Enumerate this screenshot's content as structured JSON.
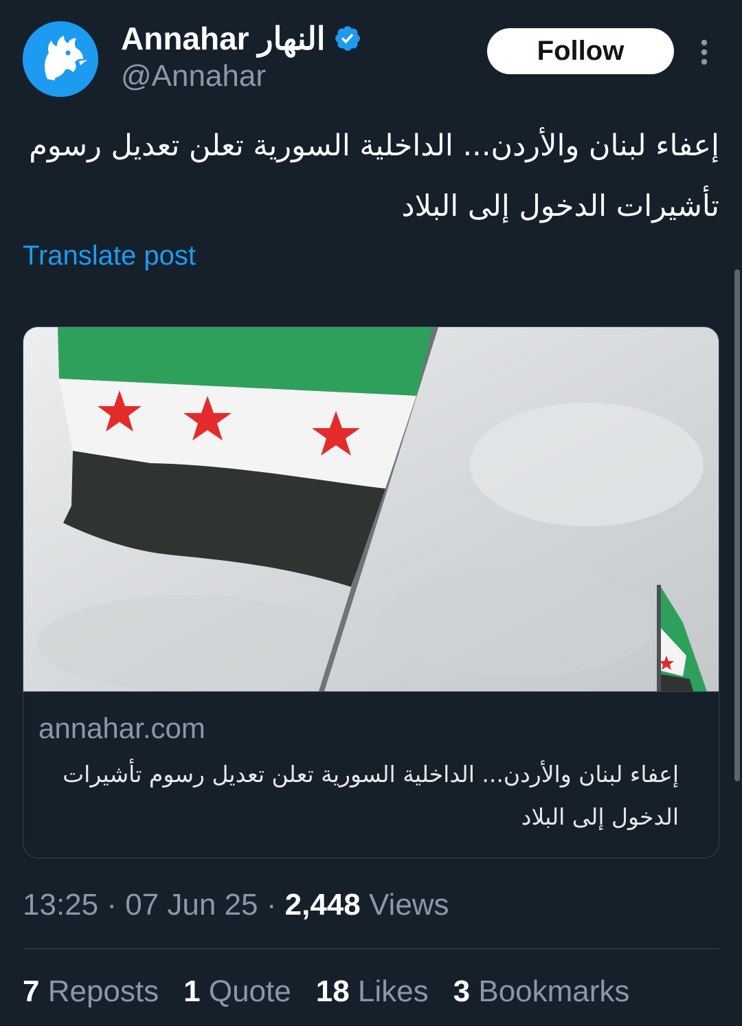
{
  "account": {
    "display_name": "Annahar النهار",
    "handle": "@Annahar",
    "verified": true,
    "avatar_color": "#1d9bf0"
  },
  "header": {
    "follow_label": "Follow"
  },
  "post": {
    "text": "إعفاء لبنان والأردن... الداخلية السورية تعلن تعديل رسوم تأشيرات الدخول إلى البلاد",
    "translate_label": "Translate post"
  },
  "card": {
    "domain": "annahar.com",
    "title": "إعفاء لبنان والأردن... الداخلية السورية تعلن تعديل رسوم تأشيرات الدخول إلى البلاد"
  },
  "meta": {
    "time": "13:25",
    "separator": "·",
    "date": "07 Jun 25",
    "views_count": "2,448",
    "views_label": "Views"
  },
  "stats": {
    "reposts_count": "7",
    "reposts_label": "Reposts",
    "quotes_count": "1",
    "quotes_label": "Quote",
    "likes_count": "18",
    "likes_label": "Likes",
    "bookmarks_count": "3",
    "bookmarks_label": "Bookmarks"
  },
  "colors": {
    "background": "#15202b",
    "accent": "#1d9bf0",
    "secondary_text": "#8b98a5",
    "border": "#38444d"
  },
  "icons": {
    "verified": "verified-badge-icon",
    "more": "more-vertical-icon",
    "avatar": "annahar-rooster-logo"
  }
}
